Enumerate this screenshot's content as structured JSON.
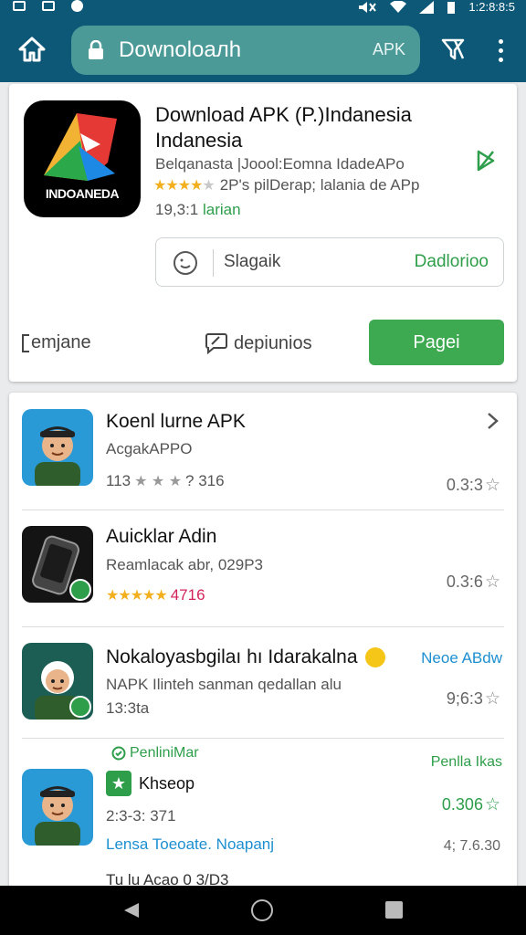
{
  "status_bar": {
    "time": "1:2:8:8:5"
  },
  "toolbar": {
    "search_text": "Downoloaлh",
    "search_tag": "APK"
  },
  "hero": {
    "icon_word": "INDOANEDA",
    "title": "Download APK (P.)Indanesia Indanesia",
    "developer": "Belqanasta |Joool:Eomna IdadeAPo",
    "rating_text": "2P's pilDerap; lalania de APp",
    "installs_num": "19,3:1 ",
    "installs_word": "larian",
    "action_label": "Slagaik",
    "action_link": "Dadlorioo",
    "left_label": "emjane",
    "mid_label": "depiunios",
    "install_button": "Pagei"
  },
  "list": {
    "items": [
      {
        "name": "Koenl lurne APK",
        "sub": "AcgakAPPO",
        "meta_left": "113",
        "meta_right": "? 316",
        "value": "0.3:3"
      },
      {
        "name": "Auicklar Adin",
        "sub": "Reamlacak abr, 029P3",
        "meta_right": "4716",
        "value": "0.3:6"
      },
      {
        "name": "Nokaloyasbgilaı hı Idarakalna",
        "tag": "Neoe ABdw",
        "sub": "NAPK Ilinteh sanman qedallan alu",
        "meta": "13:3ta",
        "value": "9;6:3"
      },
      {
        "promo_label": "PenliniMar",
        "promo_right": "Penlla Ikas",
        "name": "Khsеор",
        "meta": "2:3-3: 371",
        "value": "0.306",
        "link": "Lensa Toeoate. Noapanj",
        "small_val": "4; 7.6.30"
      }
    ],
    "cut_text": "Tu lu Acao 0 3/D3"
  }
}
